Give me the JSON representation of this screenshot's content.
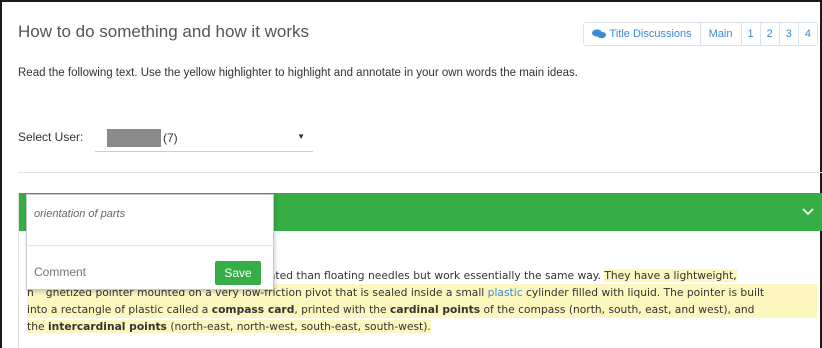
{
  "header": {
    "title": "How to do something and how it works",
    "nav": {
      "discussions_label": "Title Discussions",
      "discussions_icon": "chat-bubbles-icon",
      "main_label": "Main",
      "pages": [
        "1",
        "2",
        "3",
        "4"
      ]
    }
  },
  "instructions": "Read the following text. Use the yellow highlighter to highlight and annotate in your own words the main ideas.",
  "user_select": {
    "label": "Select User:",
    "value": "(7)"
  },
  "colors": {
    "accent_green": "#36ad45",
    "highlight_yellow": "#fbf7bf",
    "link_blue": "#3a8ad6"
  },
  "annotation_popup": {
    "quote": "orientation of parts",
    "comment_placeholder": "Comment",
    "save_label": "Save"
  },
  "passage": {
    "l1_plain": "cated than floating needles but work essentially the same way. ",
    "l1_hl": "They have a lightweight,",
    "l2_a": "n",
    "l2_b": "gnetized pointer mounted on a very low-friction pivot that is sealed inside a small ",
    "l2_link": "plastic",
    "l2_c": " cylinder filled with liquid. The pointer is built",
    "l3_a": "into a rectangle of plastic called a ",
    "l3_b1": "compass card",
    "l3_c": ", printed with the ",
    "l3_b2": "cardinal points",
    "l3_d": " of the compass (north, south, east, and west), and",
    "l4_a": "the ",
    "l4_b": "intercardinal points",
    "l4_c": " (north-east, north-west, south-east, south-west)."
  }
}
